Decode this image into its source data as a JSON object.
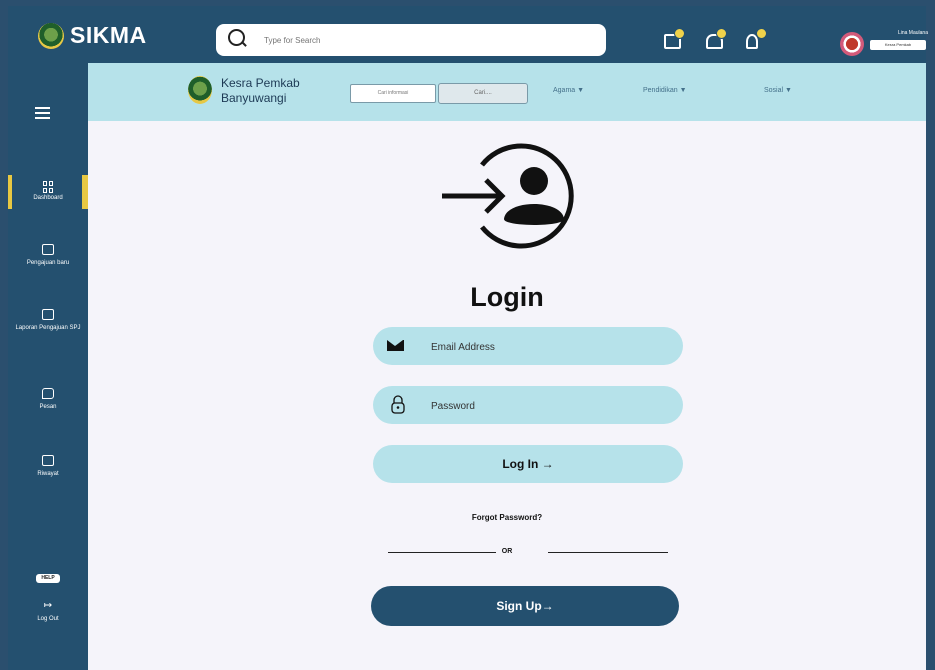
{
  "app": {
    "title": "SIKMA"
  },
  "search": {
    "placeholder": "Type for Search"
  },
  "topbar_user": {
    "name": "Lina Maulana",
    "role": "Kesra Pemkab"
  },
  "subheader": {
    "title_line1": "Kesra Pemkab",
    "title_line2": "Banyuwangi",
    "field_a": "Cari informasi",
    "field_b": "Cari....",
    "menus": [
      "Agama ▼",
      "Pendidikan ▼",
      "Sosial ▼"
    ]
  },
  "sidebar": {
    "items": [
      {
        "label": "Dashboard",
        "icon": "grid-icon"
      },
      {
        "label": "Pengajuan baru",
        "icon": "briefcase-icon"
      },
      {
        "label": "Laporan Pengajuan SPJ",
        "icon": "calendar-icon"
      },
      {
        "label": "Pesan",
        "icon": "chat-icon"
      },
      {
        "label": "Riwayat",
        "icon": "calendar-icon"
      }
    ],
    "help": "HELP",
    "logout": "Log Out"
  },
  "login": {
    "title": "Login",
    "email_placeholder": "Email Address",
    "password_placeholder": "Password",
    "login_button": "Log In →",
    "forgot": "Forgot Password?",
    "or": "OR",
    "signup_button": "Sign Up→"
  },
  "colors": {
    "navy": "#24506f",
    "light_blue": "#b6e2ea",
    "accent_yellow": "#e8c842"
  }
}
